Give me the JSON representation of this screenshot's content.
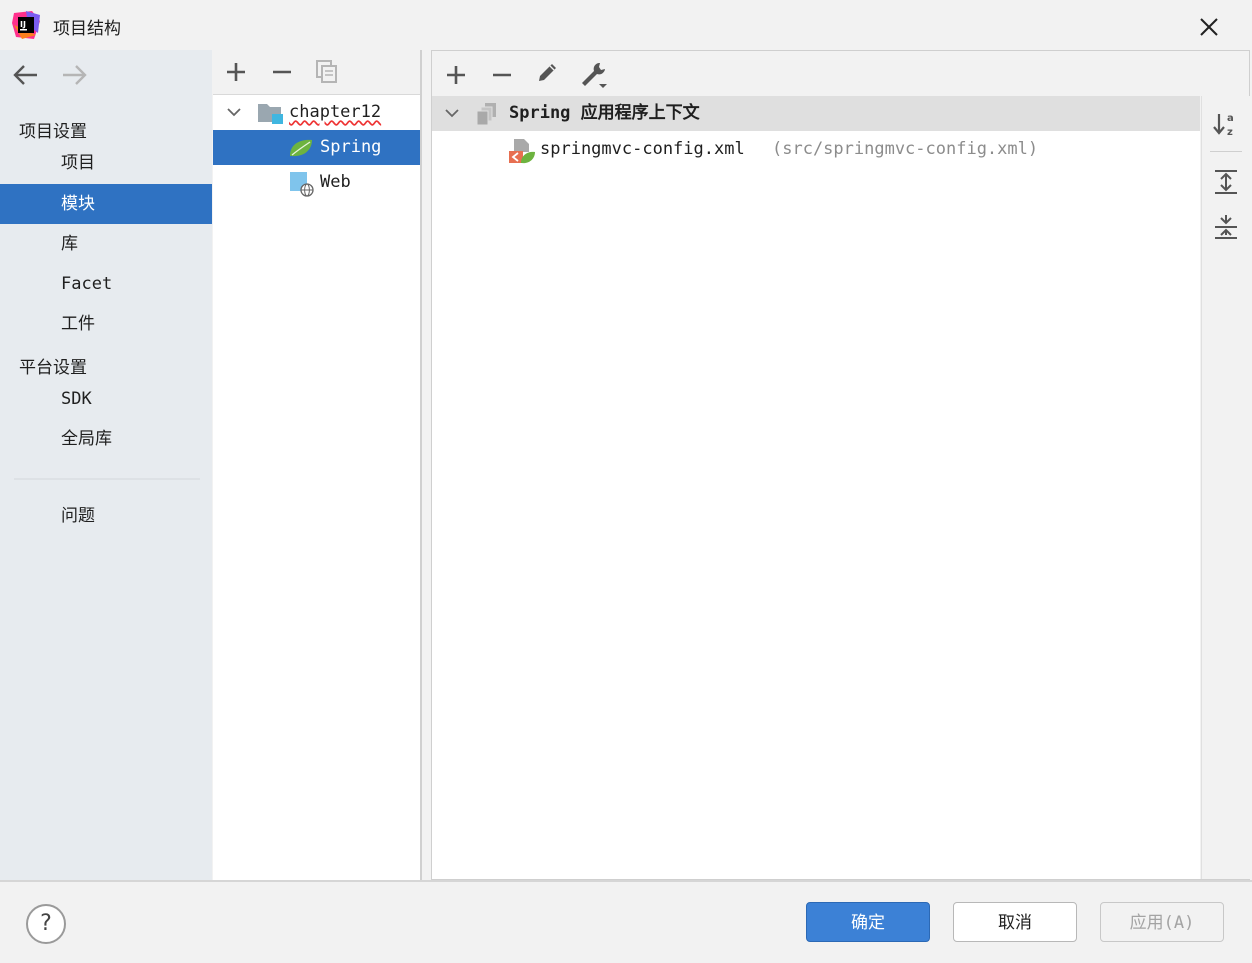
{
  "window": {
    "title": "项目结构"
  },
  "sidebar": {
    "groups": [
      {
        "label": "项目设置"
      },
      {
        "label": "平台设置"
      }
    ],
    "items": [
      {
        "label": "项目"
      },
      {
        "label": "模块",
        "selected": true
      },
      {
        "label": "库"
      },
      {
        "label": "Facet"
      },
      {
        "label": "工件"
      },
      {
        "label": "SDK"
      },
      {
        "label": "全局库"
      },
      {
        "label": "问题"
      }
    ]
  },
  "module_tree": {
    "root": {
      "label": "chapter12",
      "expanded": true
    },
    "children": [
      {
        "label": "Spring",
        "icon": "spring-leaf-icon",
        "selected": true
      },
      {
        "label": "Web",
        "icon": "web-facet-icon"
      }
    ]
  },
  "spring_panel": {
    "context": {
      "label": "Spring 应用程序上下文",
      "expanded": true
    },
    "files": [
      {
        "name": "springmvc-config.xml",
        "path": "(src/springmvc-config.xml)"
      }
    ]
  },
  "footer": {
    "help": "?",
    "ok": "确定",
    "cancel": "取消",
    "apply": "应用(A)"
  },
  "colors": {
    "selection": "#2f72c2",
    "primary_button": "#3c81d6",
    "spring_green": "#6db33f"
  }
}
